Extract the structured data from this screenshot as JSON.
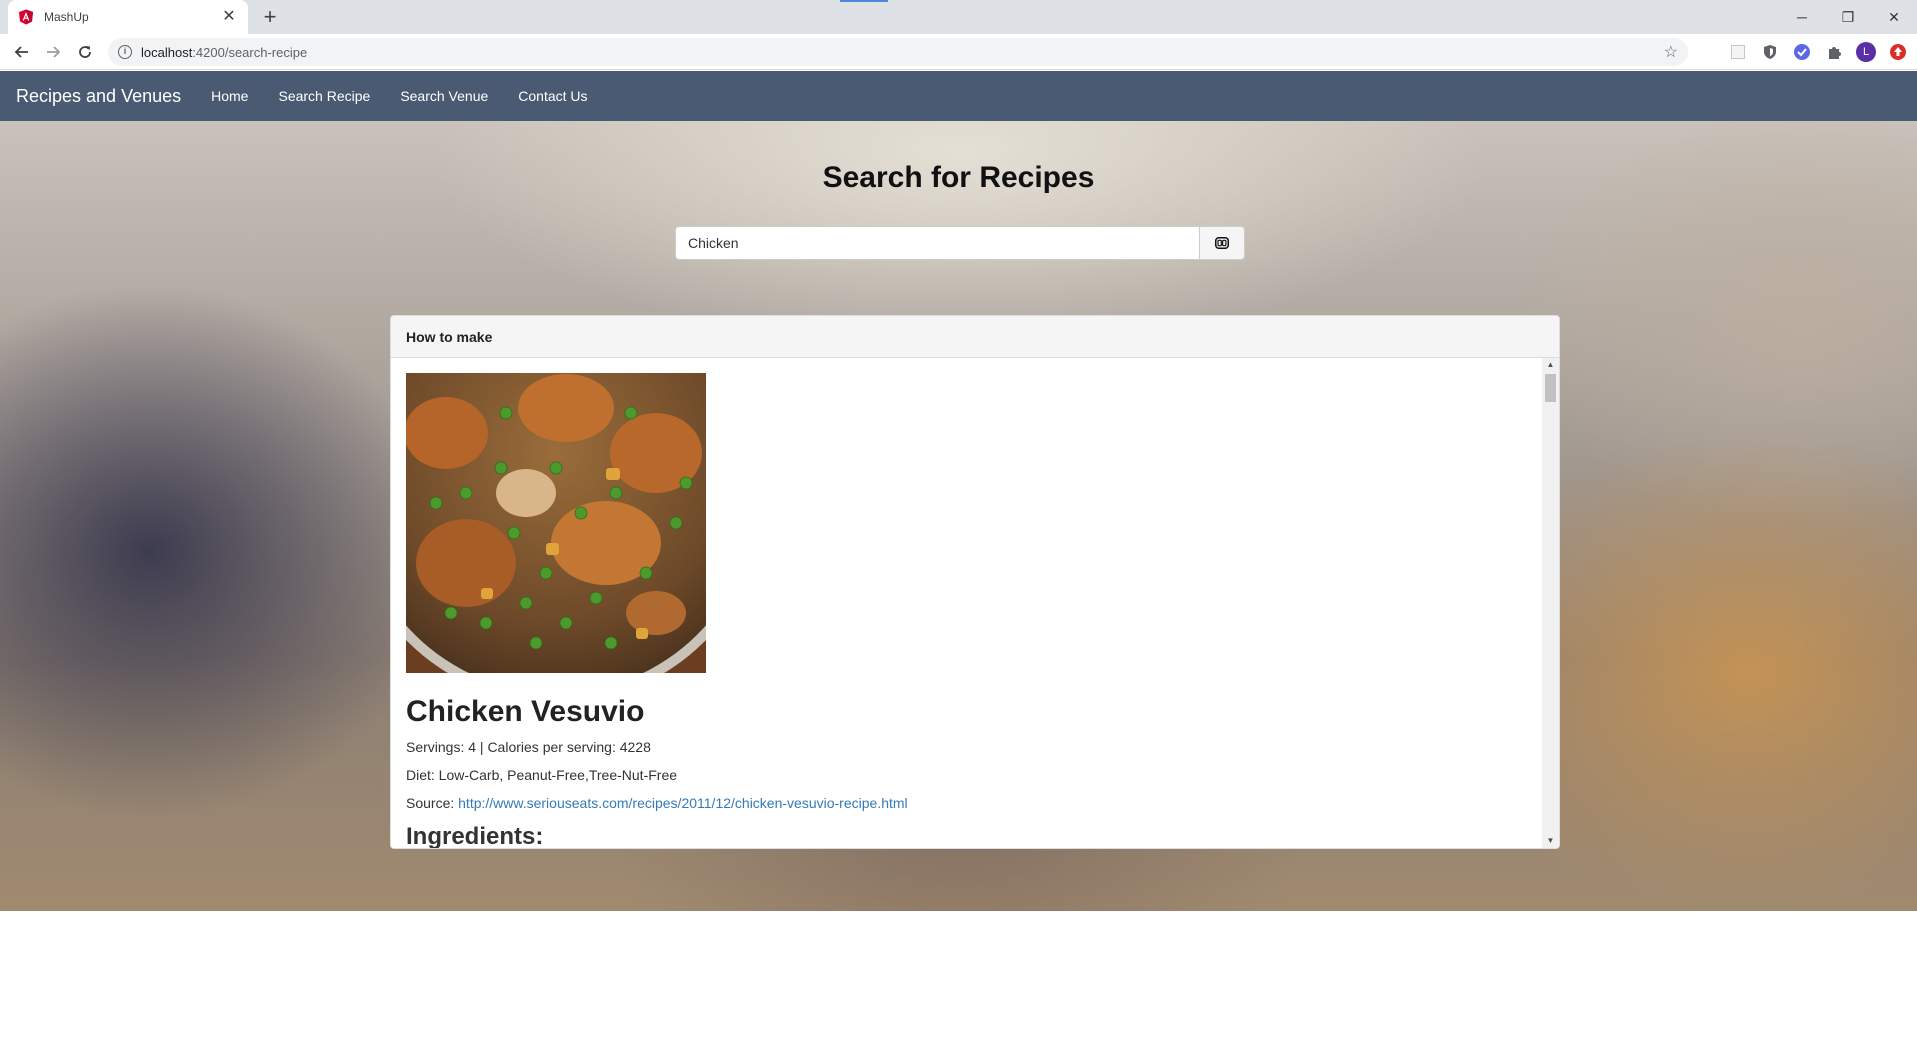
{
  "browser": {
    "tab_title": "MashUp",
    "close_glyph": "✕",
    "new_tab_glyph": "+",
    "url_host": "localhost",
    "url_path": ":4200/search-recipe",
    "window_controls": {
      "minimize": "─",
      "restore": "❐",
      "close": "✕"
    },
    "profile_initial": "L"
  },
  "navbar": {
    "brand": "Recipes and Venues",
    "links": [
      "Home",
      "Search Recipe",
      "Search Venue",
      "Contact Us"
    ],
    "background": "#4a5a73"
  },
  "search": {
    "heading": "Search for Recipes",
    "value": "Chicken",
    "button_icon": "go-icon"
  },
  "panel": {
    "heading": "How to make",
    "recipe": {
      "title": "Chicken Vesuvio",
      "servings_label": "Servings: 4 | Calories per serving: 4228",
      "diet_label": "Diet: Low-Carb, Peanut-Free,Tree-Nut-Free",
      "source_prefix": "Source: ",
      "source_url": "http://www.seriouseats.com/recipes/2011/12/chicken-vesuvio-recipe.html",
      "ingredients_heading": "Ingredients:"
    }
  },
  "colors": {
    "link": "#337ab7",
    "angular_red": "#dd0031"
  }
}
